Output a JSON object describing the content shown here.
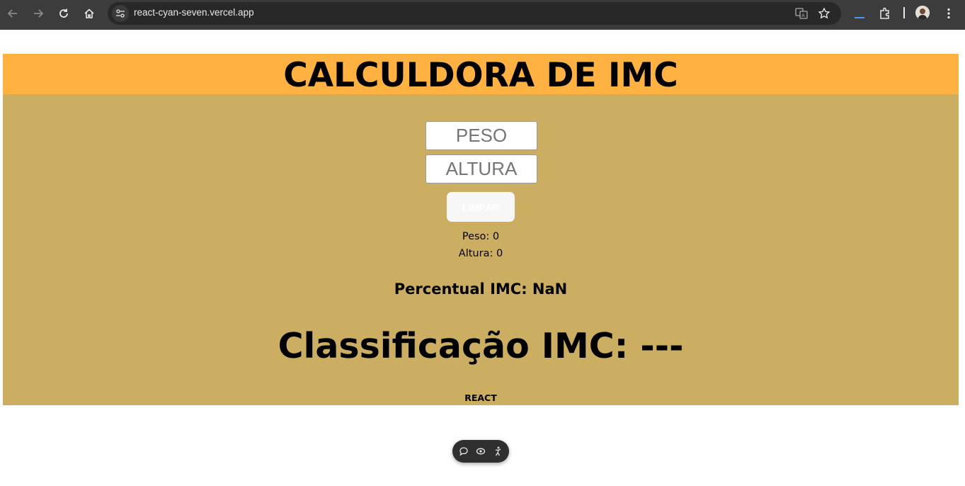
{
  "browser": {
    "url": "react-cyan-seven.vercel.app",
    "icons": [
      "back-icon",
      "forward-icon",
      "reload-icon",
      "home-icon",
      "site-settings-icon",
      "translate-icon",
      "bookmark-star-icon",
      "download-icon",
      "extensions-icon",
      "profile-avatar",
      "menu-kebab-icon"
    ]
  },
  "page": {
    "title": "CALCULDORA DE IMC",
    "peso_placeholder": "PESO",
    "altura_placeholder": "ALTURA",
    "clear_button": "LIMPAR",
    "peso_readout": "Peso: 0",
    "altura_readout": "Altura: 0",
    "percentual": "Percentual IMC: NaN",
    "classificacao": "Classificação IMC: ---",
    "footer": "REACT"
  },
  "colors": {
    "header_bg": "#ffb142",
    "main_bg": "#cbae62",
    "chrome_bg": "#3c3c3c"
  },
  "floating_toolbar": {
    "icons": [
      "comment-icon",
      "view-icon",
      "accessibility-icon"
    ]
  }
}
